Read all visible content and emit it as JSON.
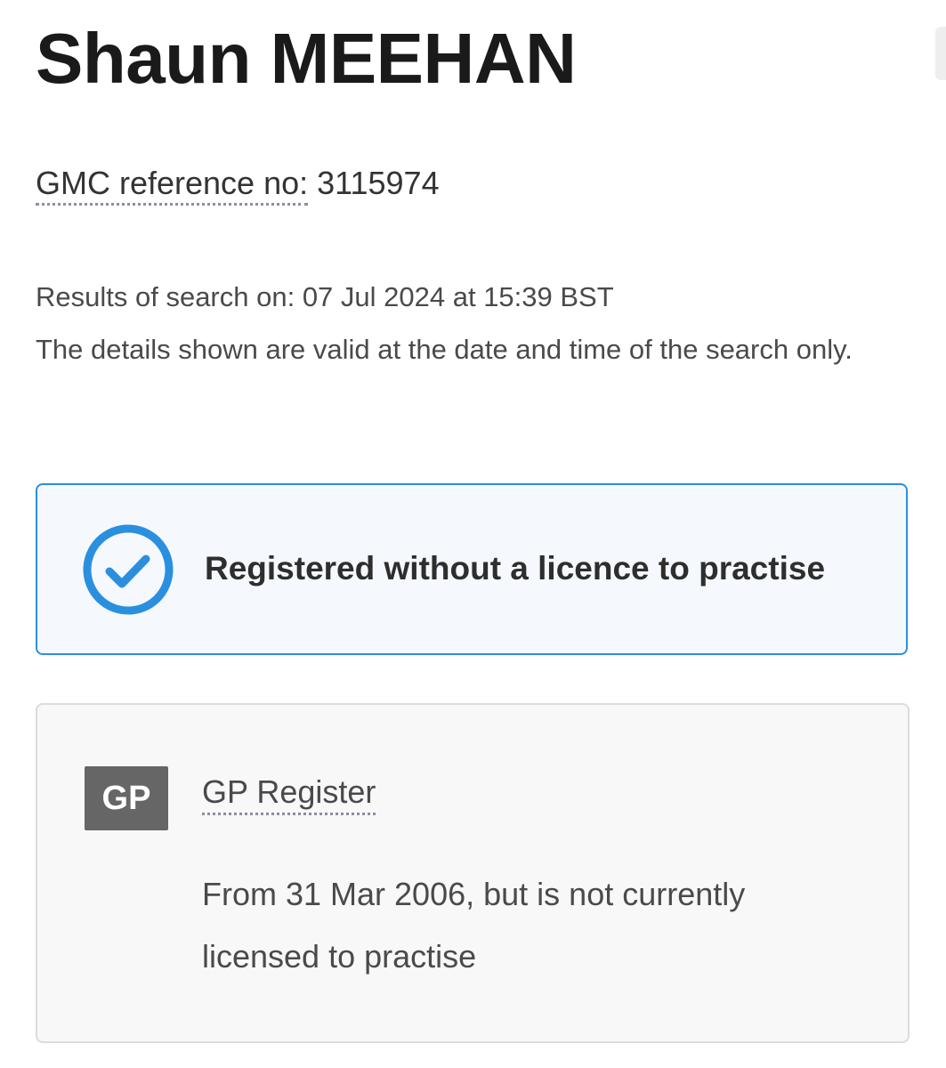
{
  "doctor": {
    "name": "Shaun MEEHAN",
    "gmc_label": "GMC reference no:",
    "gmc_number": "3115974"
  },
  "search": {
    "results_line": "Results of search on: 07 Jul 2024 at 15:39 BST",
    "validity_note": "The details shown are valid at the date and time of the search only."
  },
  "status": {
    "icon": "check-circle-icon",
    "text": "Registered without a licence to practise",
    "accent_color": "#2b8fe0"
  },
  "register": {
    "badge": "GP",
    "name": "GP Register",
    "detail": "From 31 Mar 2006, but is not currently licensed to practise"
  }
}
